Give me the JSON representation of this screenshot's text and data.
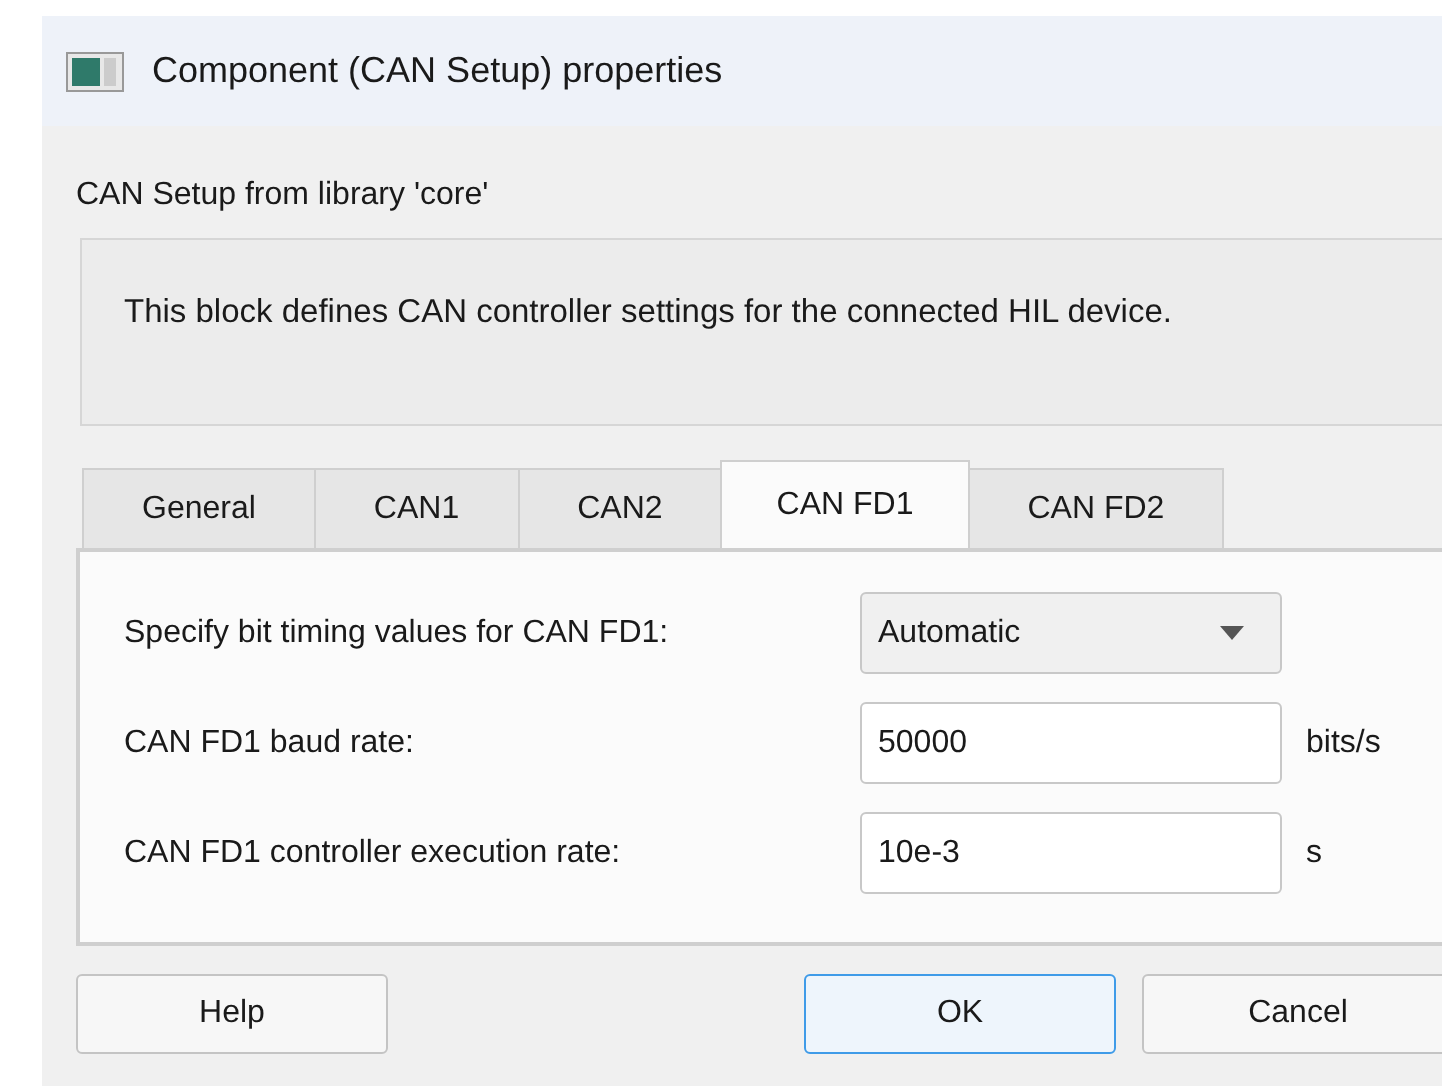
{
  "window": {
    "title": "Component (CAN Setup) properties"
  },
  "source": "CAN Setup from library 'core'",
  "description": "This block defines CAN controller settings for the connected HIL device.",
  "tabs": [
    {
      "label": "General",
      "selected": false
    },
    {
      "label": "CAN1",
      "selected": false
    },
    {
      "label": "CAN2",
      "selected": false
    },
    {
      "label": "CAN FD1",
      "selected": true
    },
    {
      "label": "CAN FD2",
      "selected": false
    }
  ],
  "fields": [
    {
      "kind": "dropdown",
      "label": "Specify bit timing values for CAN FD1:",
      "value": "Automatic"
    },
    {
      "kind": "text",
      "label": "CAN FD1 baud rate:",
      "value": "50000",
      "unit": "bits/s"
    },
    {
      "kind": "text",
      "label": "CAN FD1 controller execution rate:",
      "value": "10e-3",
      "unit": "s"
    }
  ],
  "buttons": [
    {
      "label": "Help",
      "kind": "help",
      "default": false
    },
    {
      "label": "OK",
      "kind": "ok",
      "default": true
    },
    {
      "label": "Cancel",
      "kind": "cancel",
      "default": false
    }
  ]
}
